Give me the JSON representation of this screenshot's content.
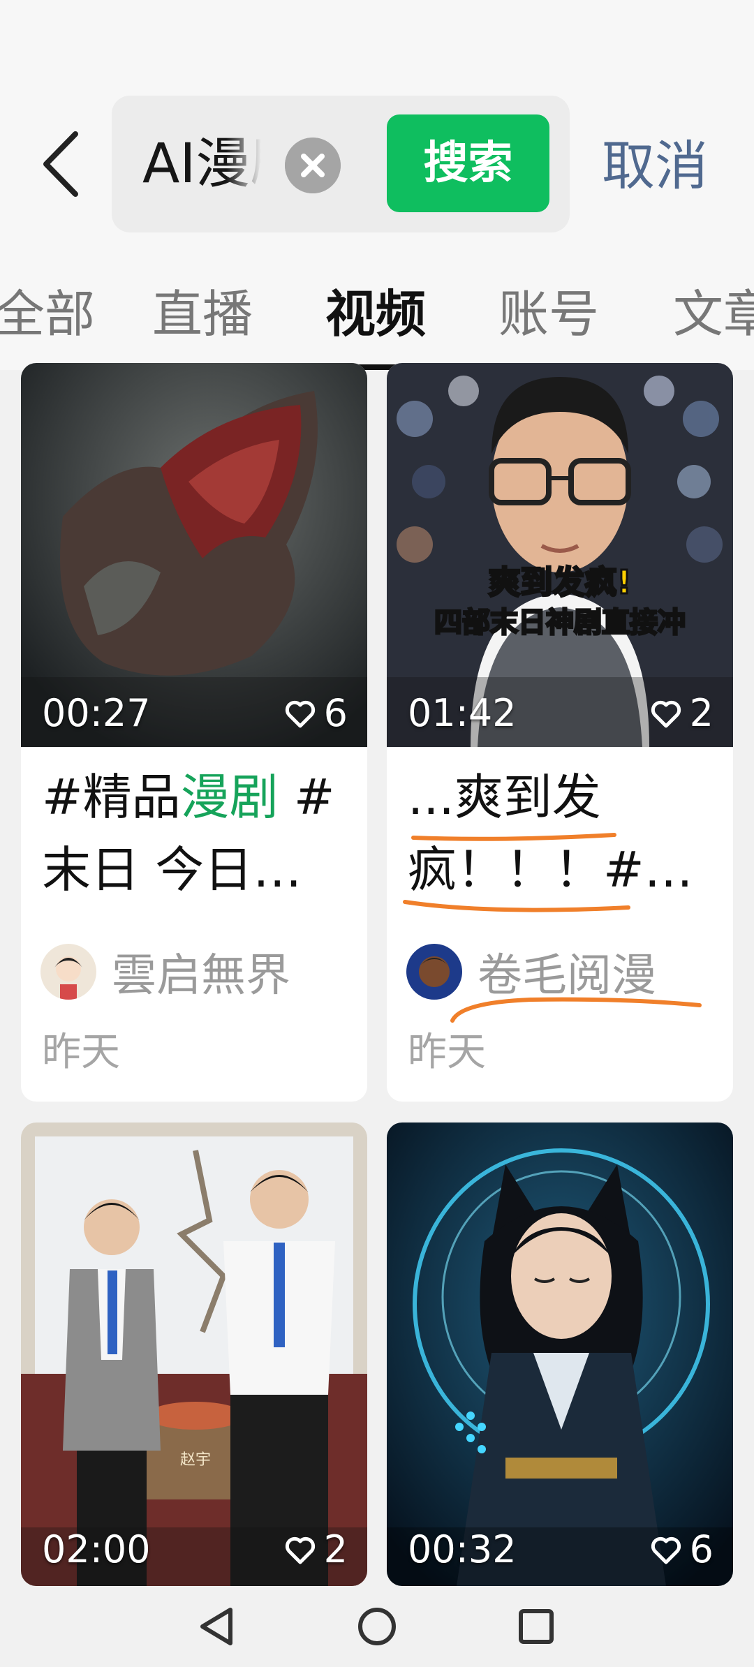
{
  "search": {
    "value": "AI漫剧",
    "clear_icon": "clear-circle-icon",
    "button_label": "搜索",
    "cancel_label": "取消"
  },
  "tabs": [
    {
      "label": "全部",
      "active": false
    },
    {
      "label": "直播",
      "active": false
    },
    {
      "label": "视频",
      "active": true
    },
    {
      "label": "账号",
      "active": false
    },
    {
      "label": "文章",
      "active": false
    }
  ],
  "videos": [
    {
      "duration": "00:27",
      "likes": "6",
      "title_prefix": "#精品",
      "title_highlight": "漫剧",
      "title_rest": " #末日 今日…",
      "author": "雲启無界",
      "date": "昨天"
    },
    {
      "duration": "01:42",
      "likes": "2",
      "title_text": "...爽到发疯！！！#…",
      "thumb_caption_line1": "爽到发疯!",
      "thumb_caption_line2": "四部末日神剧直接冲",
      "author": "卷毛阅漫",
      "date": "昨天"
    },
    {
      "duration": "02:00",
      "likes": "2",
      "thumb_sign": "赵宇"
    },
    {
      "duration": "00:32",
      "likes": "6"
    }
  ],
  "colors": {
    "accent_green": "#0fbe5f",
    "cancel_blue": "#50698f",
    "annotation_orange": "#f07f2a"
  },
  "nav_icons": [
    "back-triangle-icon",
    "home-circle-icon",
    "recents-square-icon"
  ]
}
